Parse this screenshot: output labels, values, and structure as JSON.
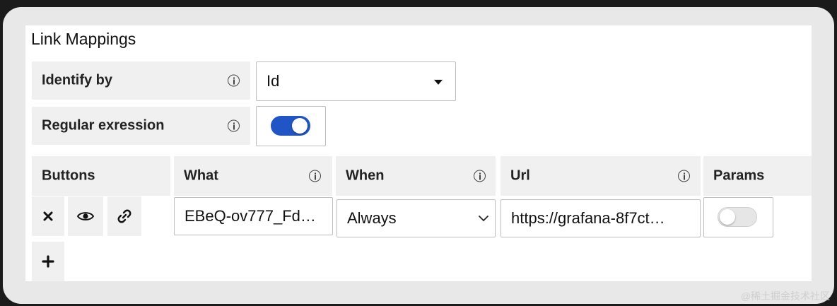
{
  "panel": {
    "title": "Link Mappings"
  },
  "identify_by": {
    "label": "Identify by",
    "value": "Id"
  },
  "regular_expression": {
    "label": "Regular exression",
    "enabled": true
  },
  "columns": {
    "buttons": "Buttons",
    "what": "What",
    "when": "When",
    "url": "Url",
    "params": "Params"
  },
  "row": {
    "what": "EBeQ-ov777_Fd…",
    "when": "Always",
    "url": "https://grafana-8f7ct…",
    "params_enabled": false
  },
  "icons": {
    "remove": "x-icon",
    "preview": "eye-icon",
    "link": "link-icon",
    "add": "plus-icon",
    "info": "info-icon"
  },
  "colors": {
    "toggle_on": "#1f55c4",
    "label_bg": "#f0f0f0"
  },
  "watermark": "@稀土掘金技术社区"
}
